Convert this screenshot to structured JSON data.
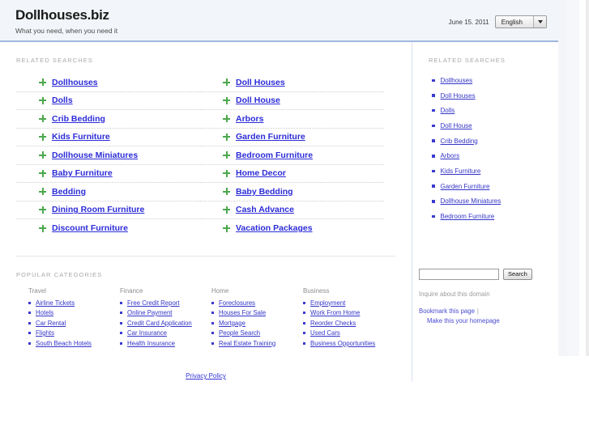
{
  "header": {
    "title": "Dollhouses.biz",
    "tagline": "What you need, when you need it",
    "date": "June 15. 2011",
    "language": "English"
  },
  "main": {
    "related_label": "RELATED SEARCHES",
    "related_left": [
      "Dollhouses",
      "Dolls",
      "Crib Bedding",
      "Kids Furniture",
      "Dollhouse Miniatures",
      "Baby Furniture",
      "Bedding",
      "Dining Room Furniture",
      "Discount Furniture"
    ],
    "related_right": [
      "Doll Houses",
      "Doll House",
      "Arbors",
      "Garden Furniture",
      "Bedroom Furniture",
      "Home Decor",
      "Baby Bedding",
      "Cash Advance",
      "Vacation Packages"
    ],
    "categories_label": "POPULAR CATEGORIES",
    "categories": [
      {
        "heading": "Travel",
        "links": [
          "Airline Tickets",
          "Hotels",
          "Car Rental",
          "Flights",
          "South Beach Hotels"
        ]
      },
      {
        "heading": "Finance",
        "links": [
          "Free Credit Report",
          "Online Payment",
          "Credit Card Application",
          "Car Insurance",
          "Health Insurance"
        ]
      },
      {
        "heading": "Home",
        "links": [
          "Foreclosures",
          "Houses For Sale",
          "Mortgage",
          "People Search",
          "Real Estate Training"
        ]
      },
      {
        "heading": "Business",
        "links": [
          "Employment",
          "Work From Home",
          "Reorder Checks",
          "Used Cars",
          "Business Opportunities"
        ]
      }
    ]
  },
  "sidebar": {
    "related_label": "RELATED SEARCHES",
    "links": [
      "Dollhouses",
      "Doll Houses",
      "Dolls",
      "Doll House",
      "Crib Bedding",
      "Arbors",
      "Kids Furniture",
      "Garden Furniture",
      "Dollhouse Miniatures",
      "Bedroom Furniture"
    ],
    "search_value": "",
    "search_placeholder": "",
    "search_button": "Search",
    "inquire_text": "Inquire about this domain",
    "bookmark_link": "Bookmark this page",
    "homepage_link": "Make this your homepage"
  },
  "footer": {
    "privacy_link": "Privacy Policy"
  },
  "colors": {
    "header_bg": "#f2f6fa",
    "header_border": "#9fb8dd",
    "link_blue": "#2c2cd8",
    "bullet_green": "#4ba84b",
    "label_gray": "#a8a8a8"
  }
}
